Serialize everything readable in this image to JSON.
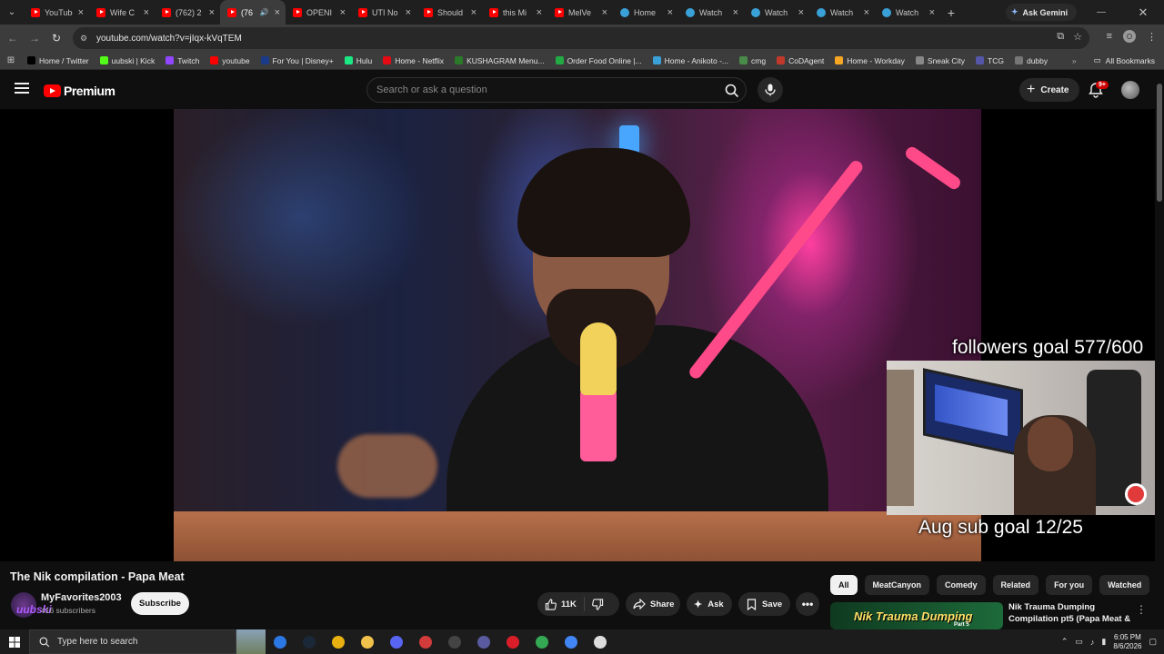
{
  "browser": {
    "tabs": [
      {
        "title": "YouTube",
        "icon": "youtube-icon",
        "active": false
      },
      {
        "title": "Wife C",
        "icon": "youtube-icon",
        "active": false
      },
      {
        "title": "(762) 2",
        "icon": "youtube-icon",
        "active": false
      },
      {
        "title": "(76",
        "icon": "youtube-icon",
        "active": true,
        "audio": true
      },
      {
        "title": "OPENI",
        "icon": "youtube-icon",
        "active": false
      },
      {
        "title": "UTI No",
        "icon": "youtube-icon",
        "active": false
      },
      {
        "title": "Should",
        "icon": "youtube-icon",
        "active": false
      },
      {
        "title": "this Mi",
        "icon": "youtube-icon",
        "active": false
      },
      {
        "title": "MelVe",
        "icon": "youtube-icon",
        "active": false
      },
      {
        "title": "Home",
        "icon": "globe-icon",
        "active": false
      },
      {
        "title": "Watch",
        "icon": "globe-icon",
        "active": false
      },
      {
        "title": "Watch",
        "icon": "globe-icon",
        "active": false
      },
      {
        "title": "Watch",
        "icon": "globe-icon",
        "active": false
      },
      {
        "title": "Watch",
        "icon": "globe-icon",
        "active": false
      }
    ],
    "gemini_label": "Ask Gemini",
    "url": "youtube.com/watch?v=jIqx-kVqTEM",
    "profile_initial": "O",
    "bookmarks": [
      {
        "label": "Home / Twitter",
        "color": "#000000"
      },
      {
        "label": "uubski | Kick",
        "color": "#53fc18"
      },
      {
        "label": "Twitch",
        "color": "#9146ff"
      },
      {
        "label": "youtube",
        "color": "#ff0000"
      },
      {
        "label": "For You | Disney+",
        "color": "#1a3a8a"
      },
      {
        "label": "Hulu",
        "color": "#1ce783"
      },
      {
        "label": "Home - Netflix",
        "color": "#e50914"
      },
      {
        "label": "KUSHAGRAM Menu...",
        "color": "#2a7a2a"
      },
      {
        "label": "Order Food Online |...",
        "color": "#22aa44"
      },
      {
        "label": "Home - Anikoto -...",
        "color": "#3aa0d8"
      },
      {
        "label": "cmg",
        "color": "#4a8a4a"
      },
      {
        "label": "CoDAgent",
        "color": "#c0392b"
      },
      {
        "label": "Home - Workday",
        "color": "#f5a623"
      },
      {
        "label": "Sneak City",
        "color": "#888888"
      },
      {
        "label": "TCG",
        "color": "#5555aa"
      },
      {
        "label": "dubby",
        "color": "#777777"
      }
    ],
    "all_bookmarks_label": "All Bookmarks"
  },
  "youtube": {
    "logo_text": "Premium",
    "search_placeholder": "Search or ask a question",
    "create_label": "Create",
    "notification_count": "9+",
    "video": {
      "overlay_followers": "followers goal 577/600",
      "overlay_subs": "Aug sub goal 12/25"
    },
    "title": "The Nik compilation - Papa Meat",
    "channel": {
      "name": "MyFavorites2003",
      "subscribers": "416 subscribers",
      "avatar_tag": "uubski"
    },
    "subscribe_label": "Subscribe",
    "actions": {
      "like_count": "11K",
      "share": "Share",
      "ask": "Ask",
      "save": "Save"
    },
    "chips": [
      "All",
      "MeatCanyon",
      "Comedy",
      "Related",
      "For you",
      "Watched"
    ],
    "recommendation": {
      "thumb_text": "Nik Trauma Dumping",
      "thumb_sub": "Part 5",
      "title": "Nik Trauma Dumping Compilation pt5 (Papa Meat & ..."
    }
  },
  "taskbar": {
    "search_placeholder": "Type here to search",
    "time": "6:05 PM",
    "date": "8/6/2026"
  }
}
